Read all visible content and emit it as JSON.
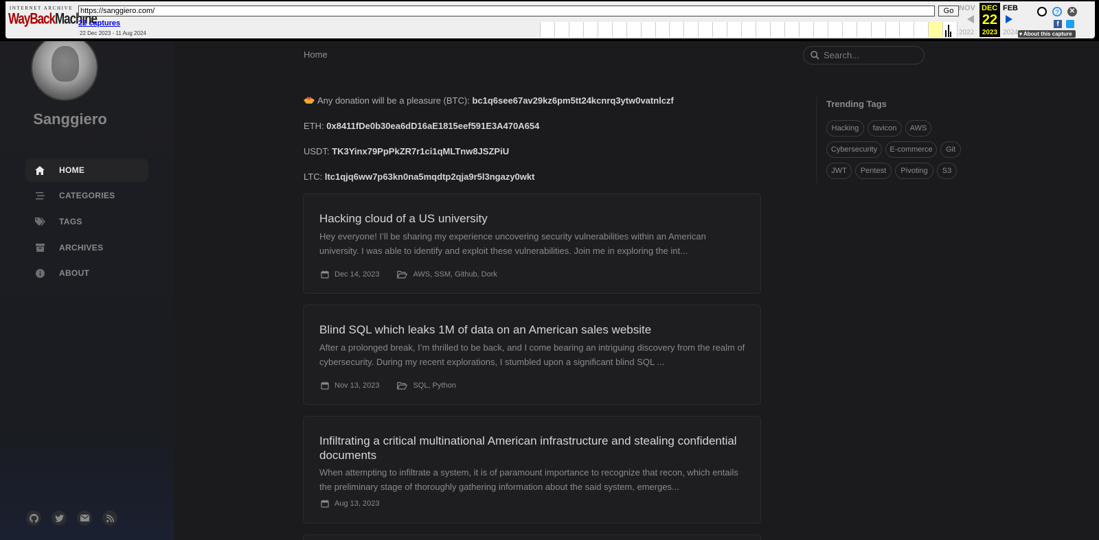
{
  "wayback": {
    "logo_top": "INTERNET ARCHIVE",
    "logo_wayback": "WayBack",
    "logo_machine": "Machine",
    "url": "https://sanggiero.com/",
    "go_label": "Go",
    "captures": "22 captures",
    "range": "22 Dec 2023 - 11 Aug 2024",
    "prev_month": "NOV",
    "cur_month": "DEC",
    "next_month": "FEB",
    "cur_day": "22",
    "prev_year": "2022",
    "cur_year": "2023",
    "next_year": "2024",
    "about": "About this capture",
    "help_glyph": "?",
    "close_glyph": "✕",
    "fb_glyph": "f"
  },
  "sidebar": {
    "site_title": "Sanggiero",
    "nav": [
      {
        "label": "HOME",
        "icon": "home-icon"
      },
      {
        "label": "CATEGORIES",
        "icon": "stream-icon"
      },
      {
        "label": "TAGS",
        "icon": "tags-icon"
      },
      {
        "label": "ARCHIVES",
        "icon": "archive-icon"
      },
      {
        "label": "ABOUT",
        "icon": "info-icon"
      }
    ],
    "social": [
      "github-icon",
      "twitter-icon",
      "email-icon",
      "rss-icon"
    ]
  },
  "topbar": {
    "breadcrumb": "Home",
    "search_placeholder": "Search..."
  },
  "donation": {
    "btc_label": "Any donation will be a pleasure (BTC):",
    "btc": "bc1q6see67av29kz6pm5tt24kcnrq3ytw0vatnlczf",
    "eth_label": "ETH:",
    "eth": "0x8411fDe0b30ea6dD16aE1815eef591E3A470A654",
    "usdt_label": "USDT:",
    "usdt": "TK3Yinx79PpPkZR7r1ci1qMLTnw8JSZPiU",
    "ltc_label": "LTC:",
    "ltc": "ltc1qjq6ww7p63kn0na5mqdtp2qja9r5l3ngazy0wkt"
  },
  "trending": {
    "title": "Trending Tags",
    "tags": [
      "Hacking",
      "favicon",
      "AWS",
      "Cybersecurity",
      "E-commerce",
      "Git",
      "JWT",
      "Pentest",
      "Pivoting",
      "S3"
    ]
  },
  "posts": [
    {
      "title": "Hacking cloud of a US university",
      "excerpt": "Hey everyone! I’ll be sharing my experience uncovering security vulnerabilities within an American university. I was able to identify and exploit these vulnerabilities. Join me in exploring the int...",
      "date": "Dec 14, 2023",
      "categories": "AWS, SSM, Github, Dork"
    },
    {
      "title": "Blind SQL which leaks 1M of data on an American sales website",
      "excerpt": "After a prolonged break, I’m thrilled to be back, and I come bearing an intriguing discovery from the realm of cybersecurity. During my recent explorations, I stumbled upon a significant blind SQL ...",
      "date": "Nov 13, 2023",
      "categories": "SQL, Python"
    },
    {
      "title": "Infiltrating a critical multinational American infrastructure and stealing confidential documents",
      "excerpt": "When attempting to infiltrate a system, it is of paramount importance to recognize that recon, which entails the preliminary stage of thoroughly gathering information about the said system, emerges...",
      "date": "Aug 13, 2023",
      "categories": ""
    }
  ],
  "colors": {
    "background": "#1b1b1e",
    "card": "#1e1e21",
    "sidebar": "#1e1e22",
    "donate_heart": "#f0a830"
  }
}
